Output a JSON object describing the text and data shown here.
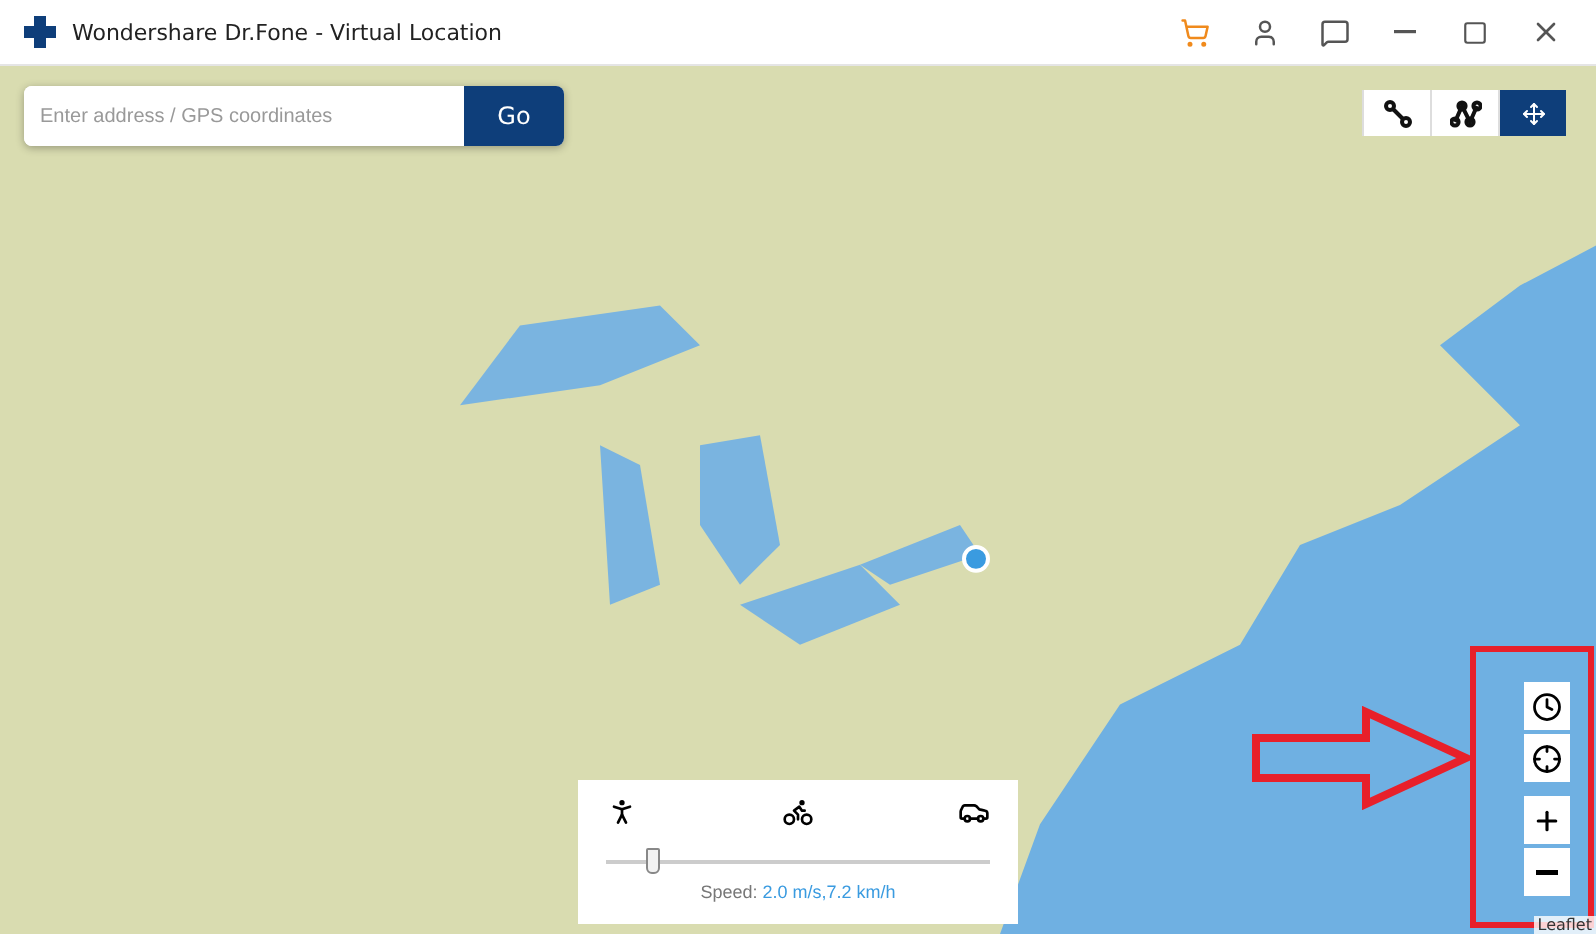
{
  "window": {
    "title": "Wondershare Dr.Fone - Virtual Location"
  },
  "search": {
    "placeholder": "Enter address / GPS coordinates",
    "button": "Go"
  },
  "route_modes": [
    {
      "kind": "two-stop",
      "selected": false
    },
    {
      "kind": "multi-stop",
      "selected": false
    },
    {
      "kind": "joystick",
      "selected": true
    }
  ],
  "speed_panel": {
    "modes": [
      {
        "kind": "walk"
      },
      {
        "kind": "bike"
      },
      {
        "kind": "car"
      }
    ],
    "level": 0.12,
    "label": "Speed:",
    "value": "2.0 m/s,7.2 km/h"
  },
  "map_controls": [
    {
      "kind": "history"
    },
    {
      "kind": "locate"
    },
    {
      "kind": "zoom-in"
    },
    {
      "kind": "zoom-out"
    }
  ],
  "attribution": "Leaflet"
}
